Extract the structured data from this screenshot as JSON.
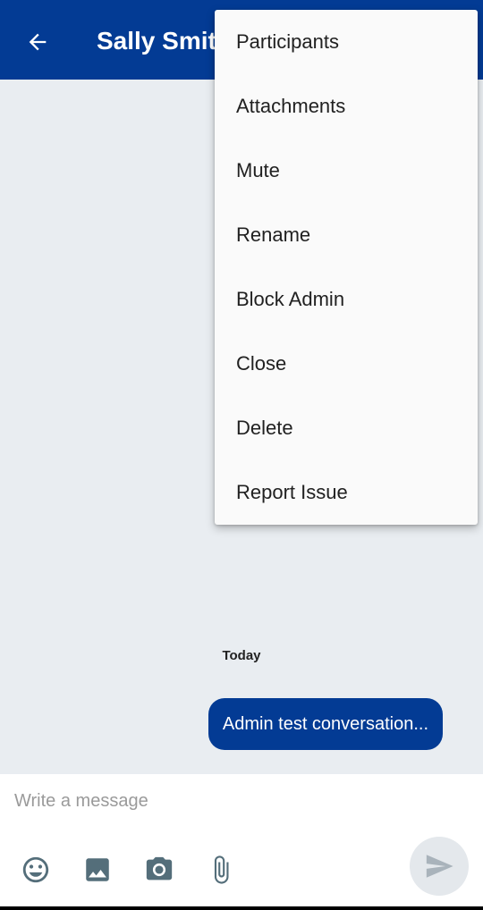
{
  "appbar": {
    "title": "Sally Smith",
    "back_icon": "arrow-left-icon",
    "background": "#033b94"
  },
  "overflow_menu": {
    "items": [
      {
        "label": "Participants"
      },
      {
        "label": "Attachments"
      },
      {
        "label": "Mute"
      },
      {
        "label": "Rename"
      },
      {
        "label": "Block Admin"
      },
      {
        "label": "Close"
      },
      {
        "label": "Delete"
      },
      {
        "label": "Report Issue"
      }
    ]
  },
  "chat": {
    "date_separator": "Today",
    "messages": [
      {
        "text": "Admin test conversation...",
        "outgoing": true
      }
    ]
  },
  "composer": {
    "placeholder": "Write a message",
    "value": "",
    "tools": [
      "emoji-icon",
      "image-icon",
      "camera-icon",
      "attach-icon"
    ],
    "send_icon": "send-icon"
  },
  "colors": {
    "brand": "#033b94",
    "chat_background": "#e9edf1",
    "icon_gray": "#546e7a"
  }
}
